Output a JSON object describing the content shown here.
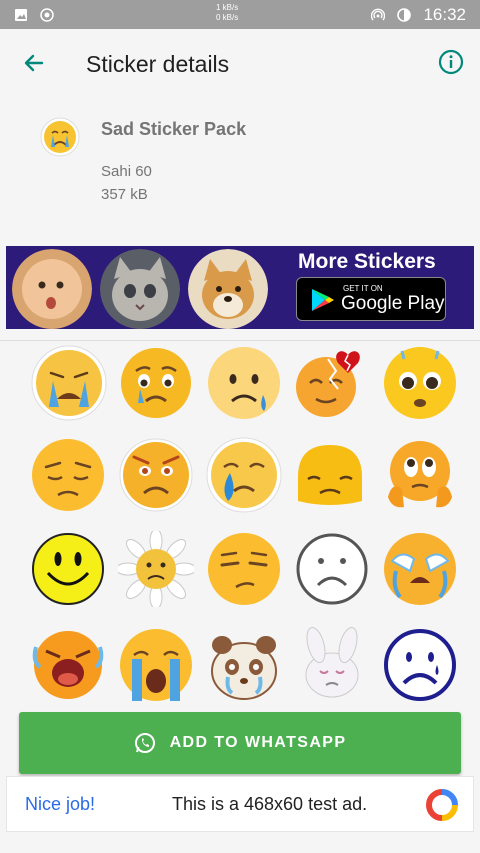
{
  "status_bar": {
    "speed_up": "1 kB/s",
    "speed_down": "0 kB/s",
    "time": "16:32"
  },
  "app_bar": {
    "title": "Sticker details",
    "back_icon": "arrow-left-icon",
    "info_icon": "info-circle-icon",
    "accent": "#00897b"
  },
  "pack": {
    "name": "Sad Sticker Pack",
    "author": "Sahi 60",
    "size": "357 kB"
  },
  "banner": {
    "title": "More Stickers",
    "store_small": "GET IT ON",
    "store_big": "Google Play",
    "bg_color": "#2d1b7a"
  },
  "stickers": [
    "crying-face",
    "sad-tearful-face",
    "sad-sweat-face",
    "broken-heart-face",
    "pleading-face",
    "pensive-face",
    "frowning-face",
    "crying-tear-face",
    "sad-blob-face",
    "worried-face",
    "smiley-face",
    "sad-flower",
    "unamused-face",
    "frowning-outline-face",
    "sobbing-face",
    "bawling-face",
    "loudly-crying-face",
    "crying-panda",
    "crying-bunny",
    "sad-blue-outline-face"
  ],
  "add_button": {
    "label": "ADD TO WHATSAPP",
    "icon": "whatsapp-icon",
    "color": "#4caf50"
  },
  "ad": {
    "left_text": "Nice job!",
    "right_text": "This is a 468x60 test ad."
  }
}
